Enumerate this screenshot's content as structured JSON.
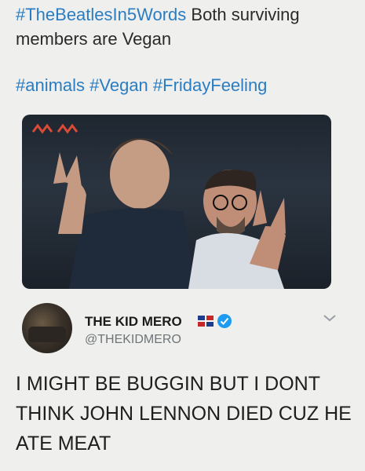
{
  "tweet": {
    "hashtag1": "#TheBeatlesIn5Words",
    "text1": " Both surviving members are Vegan",
    "hashtags": "#animals #Vegan #FridayFeeling"
  },
  "reply": {
    "name": "THE KID MERO",
    "handle": "@THEKIDMERO",
    "text": "I MIGHT BE BUGGIN BUT I DONT THINK JOHN LENNON DIED CUZ HE ATE MEAT"
  },
  "colors": {
    "hashtag": "#2a7dc2",
    "verified": "#1d9bf0"
  },
  "icons": [
    "watermark-icon",
    "flag-icon",
    "verified-icon",
    "chevron-down-icon"
  ]
}
